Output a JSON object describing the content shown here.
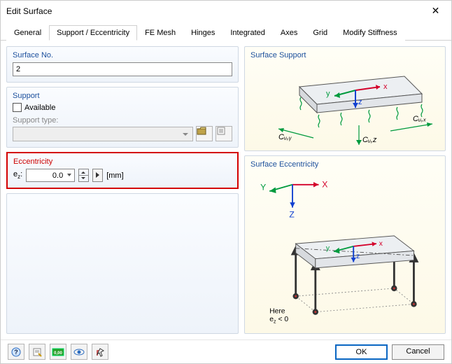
{
  "window": {
    "title": "Edit Surface"
  },
  "tabs": {
    "items": [
      {
        "label": "General"
      },
      {
        "label": "Support / Eccentricity"
      },
      {
        "label": "FE Mesh"
      },
      {
        "label": "Hinges"
      },
      {
        "label": "Integrated"
      },
      {
        "label": "Axes"
      },
      {
        "label": "Grid"
      },
      {
        "label": "Modify Stiffness"
      }
    ],
    "active_index": 1
  },
  "surface_no": {
    "title": "Surface No.",
    "value": "2"
  },
  "support": {
    "title": "Support",
    "available_label": "Available",
    "available_checked": false,
    "type_label": "Support type:",
    "type_value": ""
  },
  "eccentricity": {
    "title": "Eccentricity",
    "label_html": "e",
    "label_sub": "z",
    "value": "0.0",
    "unit": "[mm]"
  },
  "diagrams": {
    "support_title": "Surface Support",
    "ecc_title": "Surface Eccentricity",
    "ecc_note1": "Here",
    "ecc_note2_html": "e",
    "ecc_note2_sub": "z",
    "ecc_note2_rest": " < 0",
    "support_labels": {
      "cuy": "Cᵤ,ᵧ",
      "cux": "Cᵤ,ₓ",
      "cuz": "Cᵤ,ᵤ"
    },
    "axes": {
      "x": "x",
      "y": "y",
      "z": "z",
      "X": "X",
      "Y": "Y",
      "Z": "Z"
    }
  },
  "footer": {
    "ok": "OK",
    "cancel": "Cancel"
  },
  "toolbar_icons": {
    "help": "?",
    "edit": "✎",
    "units": "0.00",
    "view": "👁",
    "pick": "⇱"
  }
}
